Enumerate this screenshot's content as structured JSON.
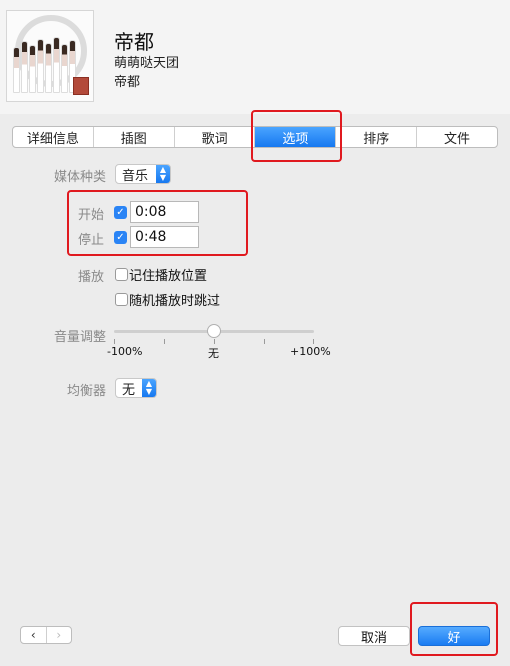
{
  "song": {
    "title": "帝都",
    "artist": "萌萌哒天团",
    "album": "帝都"
  },
  "tabs": [
    {
      "label": "详细信息",
      "active": false
    },
    {
      "label": "插图",
      "active": false
    },
    {
      "label": "歌词",
      "active": false
    },
    {
      "label": "选项",
      "active": true
    },
    {
      "label": "排序",
      "active": false
    },
    {
      "label": "文件",
      "active": false
    }
  ],
  "options": {
    "media_kind_label": "媒体种类",
    "media_kind_value": "音乐",
    "start_label": "开始",
    "start_checked": true,
    "start_value": "0:08",
    "stop_label": "停止",
    "stop_checked": true,
    "stop_value": "0:48",
    "playback_label": "播放",
    "remember_position_label": "记住播放位置",
    "remember_position_checked": false,
    "skip_shuffle_label": "随机播放时跳过",
    "skip_shuffle_checked": false,
    "volume_label": "音量调整",
    "volume_min_label": "-100%",
    "volume_mid_label": "无",
    "volume_max_label": "+100%",
    "volume_value_percent": 0,
    "equalizer_label": "均衡器",
    "equalizer_value": "无"
  },
  "footer": {
    "prev_icon": "‹",
    "next_icon": "›",
    "cancel_label": "取消",
    "ok_label": "好"
  },
  "colors": {
    "accent": "#1a7cf2",
    "highlight_box": "#e0191f"
  }
}
